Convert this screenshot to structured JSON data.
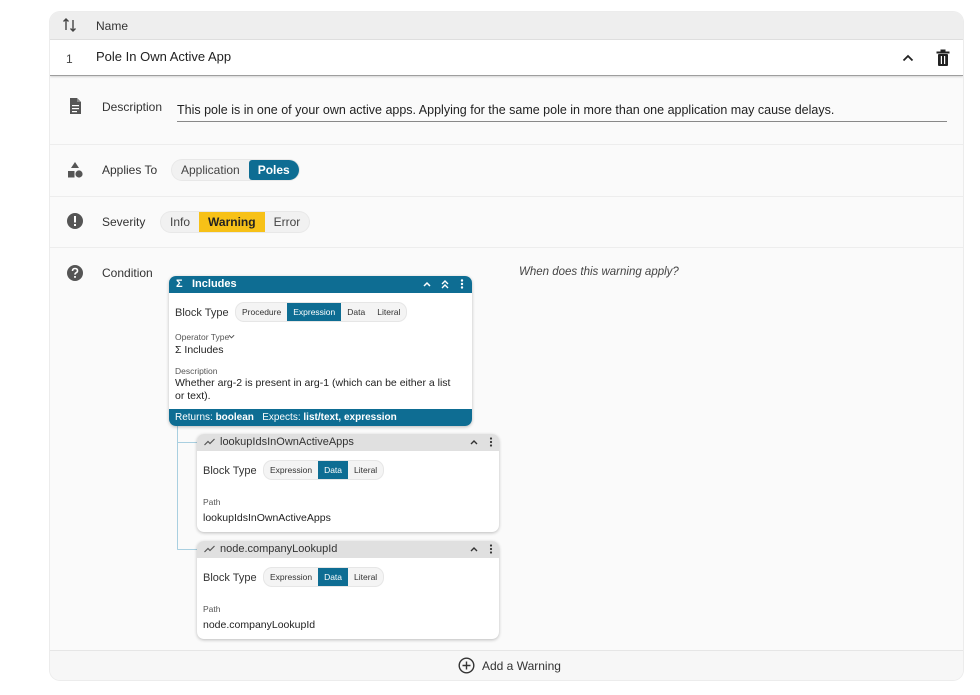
{
  "header": {
    "name_col": "Name"
  },
  "row": {
    "index": "1",
    "title": "Pole In Own Active App"
  },
  "description": {
    "label": "Description",
    "text": "This pole is in one of your own active apps. Applying for the same pole in more than one application may cause delays."
  },
  "applies_to": {
    "label": "Applies To",
    "options": [
      "Application",
      "Poles"
    ],
    "selected": "Poles"
  },
  "severity": {
    "label": "Severity",
    "options": [
      "Info",
      "Warning",
      "Error"
    ],
    "selected": "Warning"
  },
  "condition": {
    "label": "Condition",
    "hint": "When does this warning apply?",
    "main_block": {
      "sigma": "Σ",
      "title": "Includes",
      "block_type_label": "Block Type",
      "block_types": [
        "Procedure",
        "Expression",
        "Data",
        "Literal"
      ],
      "block_type_selected": "Expression",
      "operator_type_label": "Operator Type",
      "operator_value": "Σ Includes",
      "description_label": "Description",
      "description_text": "Whether arg-2 is present in arg-1 (which can be either a list or text).",
      "returns_label": "Returns:",
      "returns_value": "boolean",
      "expects_label": "Expects:",
      "expects_value": "list/text, expression"
    },
    "arg_blocks": [
      {
        "title": "lookupIdsInOwnActiveApps",
        "block_type_label": "Block Type",
        "block_types": [
          "Expression",
          "Data",
          "Literal"
        ],
        "block_type_selected": "Data",
        "path_label": "Path",
        "path_value": "lookupIdsInOwnActiveApps"
      },
      {
        "title": "node.companyLookupId",
        "block_type_label": "Block Type",
        "block_types": [
          "Expression",
          "Data",
          "Literal"
        ],
        "block_type_selected": "Data",
        "path_label": "Path",
        "path_value": "node.companyLookupId"
      }
    ]
  },
  "footer": {
    "add_label": "Add a Warning"
  },
  "colors": {
    "accent": "#0e6d93",
    "warning": "#f7c117"
  }
}
